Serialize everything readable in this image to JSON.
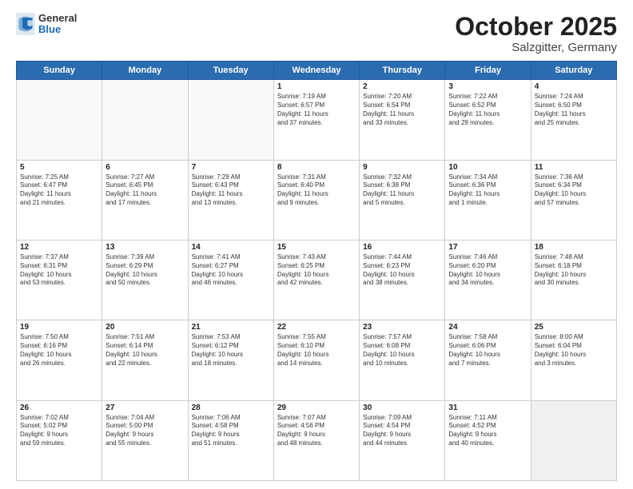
{
  "header": {
    "logo_general": "General",
    "logo_blue": "Blue",
    "month": "October 2025",
    "location": "Salzgitter, Germany"
  },
  "weekdays": [
    "Sunday",
    "Monday",
    "Tuesday",
    "Wednesday",
    "Thursday",
    "Friday",
    "Saturday"
  ],
  "weeks": [
    [
      {
        "day": "",
        "info": ""
      },
      {
        "day": "",
        "info": ""
      },
      {
        "day": "",
        "info": ""
      },
      {
        "day": "1",
        "info": "Sunrise: 7:19 AM\nSunset: 6:57 PM\nDaylight: 11 hours\nand 37 minutes."
      },
      {
        "day": "2",
        "info": "Sunrise: 7:20 AM\nSunset: 6:54 PM\nDaylight: 11 hours\nand 33 minutes."
      },
      {
        "day": "3",
        "info": "Sunrise: 7:22 AM\nSunset: 6:52 PM\nDaylight: 11 hours\nand 29 minutes."
      },
      {
        "day": "4",
        "info": "Sunrise: 7:24 AM\nSunset: 6:50 PM\nDaylight: 11 hours\nand 25 minutes."
      }
    ],
    [
      {
        "day": "5",
        "info": "Sunrise: 7:25 AM\nSunset: 6:47 PM\nDaylight: 11 hours\nand 21 minutes."
      },
      {
        "day": "6",
        "info": "Sunrise: 7:27 AM\nSunset: 6:45 PM\nDaylight: 11 hours\nand 17 minutes."
      },
      {
        "day": "7",
        "info": "Sunrise: 7:29 AM\nSunset: 6:43 PM\nDaylight: 11 hours\nand 13 minutes."
      },
      {
        "day": "8",
        "info": "Sunrise: 7:31 AM\nSunset: 6:40 PM\nDaylight: 11 hours\nand 9 minutes."
      },
      {
        "day": "9",
        "info": "Sunrise: 7:32 AM\nSunset: 6:38 PM\nDaylight: 11 hours\nand 5 minutes."
      },
      {
        "day": "10",
        "info": "Sunrise: 7:34 AM\nSunset: 6:36 PM\nDaylight: 11 hours\nand 1 minute."
      },
      {
        "day": "11",
        "info": "Sunrise: 7:36 AM\nSunset: 6:34 PM\nDaylight: 10 hours\nand 57 minutes."
      }
    ],
    [
      {
        "day": "12",
        "info": "Sunrise: 7:37 AM\nSunset: 6:31 PM\nDaylight: 10 hours\nand 53 minutes."
      },
      {
        "day": "13",
        "info": "Sunrise: 7:39 AM\nSunset: 6:29 PM\nDaylight: 10 hours\nand 50 minutes."
      },
      {
        "day": "14",
        "info": "Sunrise: 7:41 AM\nSunset: 6:27 PM\nDaylight: 10 hours\nand 46 minutes."
      },
      {
        "day": "15",
        "info": "Sunrise: 7:43 AM\nSunset: 6:25 PM\nDaylight: 10 hours\nand 42 minutes."
      },
      {
        "day": "16",
        "info": "Sunrise: 7:44 AM\nSunset: 6:23 PM\nDaylight: 10 hours\nand 38 minutes."
      },
      {
        "day": "17",
        "info": "Sunrise: 7:46 AM\nSunset: 6:20 PM\nDaylight: 10 hours\nand 34 minutes."
      },
      {
        "day": "18",
        "info": "Sunrise: 7:48 AM\nSunset: 6:18 PM\nDaylight: 10 hours\nand 30 minutes."
      }
    ],
    [
      {
        "day": "19",
        "info": "Sunrise: 7:50 AM\nSunset: 6:16 PM\nDaylight: 10 hours\nand 26 minutes."
      },
      {
        "day": "20",
        "info": "Sunrise: 7:51 AM\nSunset: 6:14 PM\nDaylight: 10 hours\nand 22 minutes."
      },
      {
        "day": "21",
        "info": "Sunrise: 7:53 AM\nSunset: 6:12 PM\nDaylight: 10 hours\nand 18 minutes."
      },
      {
        "day": "22",
        "info": "Sunrise: 7:55 AM\nSunset: 6:10 PM\nDaylight: 10 hours\nand 14 minutes."
      },
      {
        "day": "23",
        "info": "Sunrise: 7:57 AM\nSunset: 6:08 PM\nDaylight: 10 hours\nand 10 minutes."
      },
      {
        "day": "24",
        "info": "Sunrise: 7:58 AM\nSunset: 6:06 PM\nDaylight: 10 hours\nand 7 minutes."
      },
      {
        "day": "25",
        "info": "Sunrise: 8:00 AM\nSunset: 6:04 PM\nDaylight: 10 hours\nand 3 minutes."
      }
    ],
    [
      {
        "day": "26",
        "info": "Sunrise: 7:02 AM\nSunset: 5:02 PM\nDaylight: 9 hours\nand 59 minutes."
      },
      {
        "day": "27",
        "info": "Sunrise: 7:04 AM\nSunset: 5:00 PM\nDaylight: 9 hours\nand 55 minutes."
      },
      {
        "day": "28",
        "info": "Sunrise: 7:06 AM\nSunset: 4:58 PM\nDaylight: 9 hours\nand 51 minutes."
      },
      {
        "day": "29",
        "info": "Sunrise: 7:07 AM\nSunset: 4:56 PM\nDaylight: 9 hours\nand 48 minutes."
      },
      {
        "day": "30",
        "info": "Sunrise: 7:09 AM\nSunset: 4:54 PM\nDaylight: 9 hours\nand 44 minutes."
      },
      {
        "day": "31",
        "info": "Sunrise: 7:11 AM\nSunset: 4:52 PM\nDaylight: 9 hours\nand 40 minutes."
      },
      {
        "day": "",
        "info": ""
      }
    ]
  ]
}
